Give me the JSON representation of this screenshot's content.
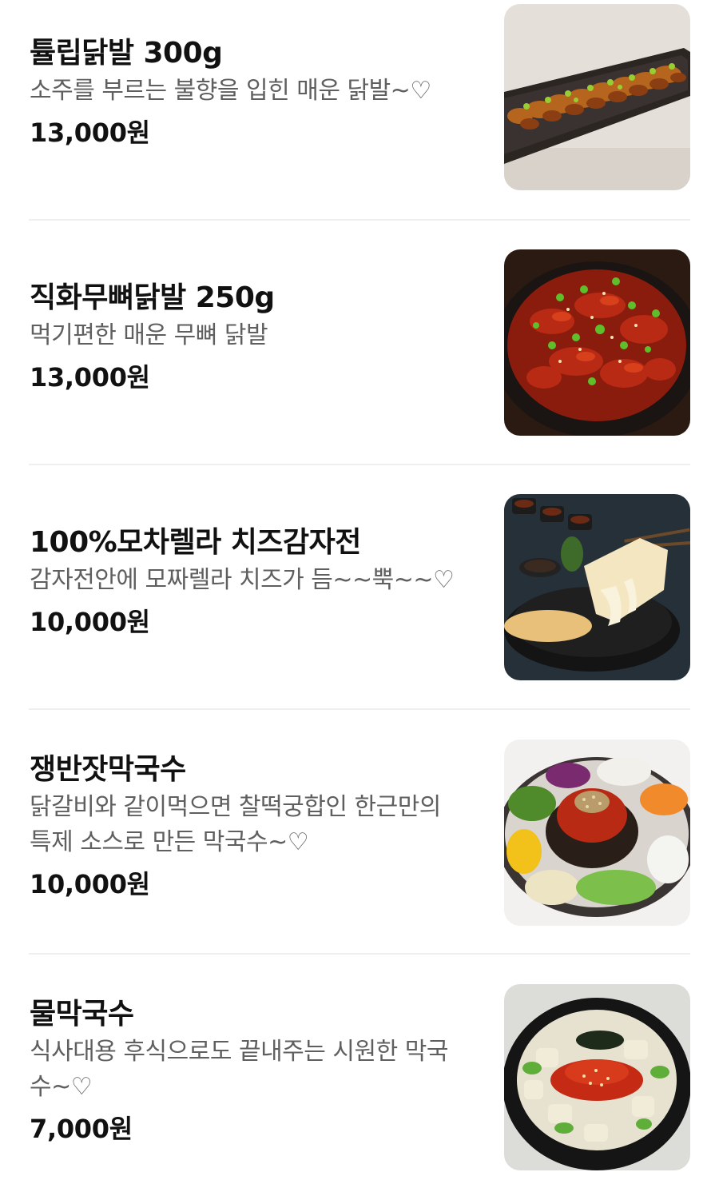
{
  "menu": {
    "items": [
      {
        "name": "튤립닭발 300g",
        "description": [
          "소주를 부르는 불향을 입힌 매운 닭발~♡"
        ],
        "price": "13,000원",
        "image_desc": "tulip chicken feet on dark tray"
      },
      {
        "name": "직화무뼈닭발 250g",
        "description": [
          "먹기편한 매운 무뼈 닭발"
        ],
        "price": "13,000원",
        "image_desc": "boneless spicy chicken feet in black bowl"
      },
      {
        "name": "100%모차렐라 치즈감자전",
        "description": [
          "감자전안에 모짜렐라 치즈가 듬~~뿍~~♡"
        ],
        "price": "10,000원",
        "image_desc": "potato pancake with stretchy cheese"
      },
      {
        "name": "쟁반잣막국수",
        "description": [
          "닭갈비와 같이먹으면 찰떡궁합인 한근만의",
          "특제 소스로 만든 막국수~♡"
        ],
        "price": "10,000원",
        "image_desc": "buckwheat noodles with vegetables on platter"
      },
      {
        "name": "물막국수",
        "description": [
          "식사대용 후식으로도 끝내주는 시원한 막국",
          "수~♡"
        ],
        "price": "7,000원",
        "image_desc": "cold noodle soup in black bowl"
      }
    ]
  }
}
